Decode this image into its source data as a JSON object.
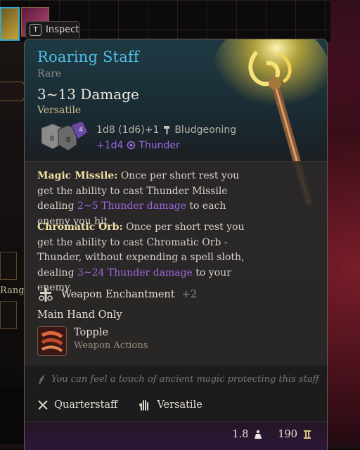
{
  "inspect": {
    "key": "T",
    "label": "Inspect"
  },
  "item": {
    "name": "Roaring Staff",
    "rarity": "Rare",
    "damage": "3~13 Damage",
    "property_tag": "Versatile",
    "dice_values": [
      "8",
      "6",
      "4"
    ],
    "damage_line": "1d8 (1d6)+1",
    "damage_type": "Bludgeoning",
    "bonus_line": "+1d4",
    "bonus_type": "Thunder"
  },
  "abilities": [
    {
      "title": "Magic Missile:",
      "text_a": "Once per short rest you get the ability to cast Thunder Missile dealing",
      "highlight": "2~5 Thunder damage",
      "text_b": "to each enemy you hit"
    },
    {
      "title": "Chromatic Orb:",
      "text_a": "Once per short rest you get the ability to cast Chromatic Orb - Thunder, without expending a spell sloth, dealing",
      "highlight": "3~24 Thunder damage",
      "text_b": "to your enemy"
    }
  ],
  "enchantment": {
    "label": "Weapon Enchantment",
    "value": "+2"
  },
  "main_hand": "Main Hand Only",
  "action": {
    "name": "Topple",
    "type": "Weapon Actions"
  },
  "lore": "You can feel a touch of ancient magic protecting this staff",
  "properties": {
    "weapon_type": "Quarterstaff",
    "property": "Versatile"
  },
  "footer": {
    "weight": "1.8",
    "value": "190"
  },
  "background": {
    "range_label": "Range"
  },
  "colors": {
    "name": "#4fbde4",
    "thunder": "#9d6ae0",
    "tag": "#d5c08a"
  },
  "icons": [
    "inspect-key-icon",
    "dice-icon",
    "hammer-icon",
    "thunder-icon",
    "enchantment-icon",
    "topple-icon",
    "feather-icon",
    "quarterstaff-icon",
    "hand-icon",
    "weight-icon",
    "gold-icon"
  ]
}
